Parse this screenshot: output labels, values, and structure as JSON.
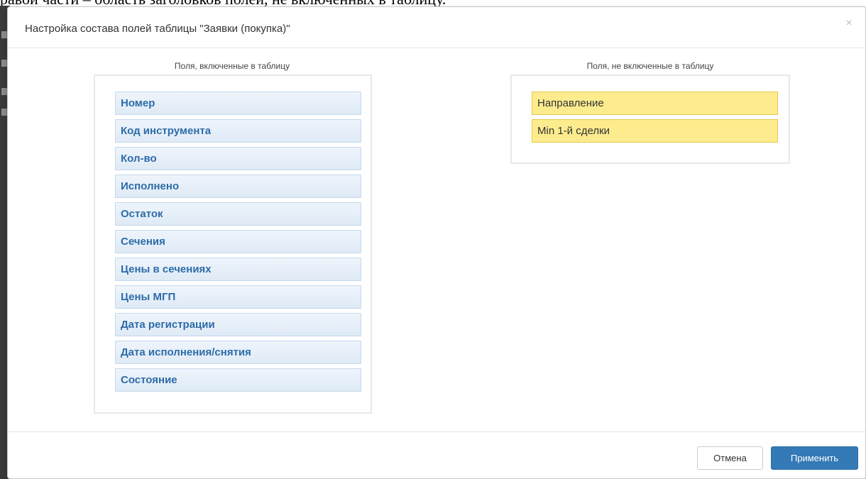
{
  "background": {
    "doc_text": "равой части – область заголовков полей, не включенных в таблицу."
  },
  "dialog": {
    "title": "Настройка состава полей таблицы \"Заявки (покупка)\"",
    "close_label": "×"
  },
  "included": {
    "title": "Поля, включенные в таблицу",
    "fields": [
      "Номер",
      "Код инструмента",
      "Кол-во",
      "Исполнено",
      "Остаток",
      "Сечения",
      "Цены в сечениях",
      "Цены МГП",
      "Дата регистрации",
      "Дата исполнения/снятия",
      "Состояние"
    ]
  },
  "excluded": {
    "title": "Поля, не включенные в таблицу",
    "fields": [
      "Направление",
      "Min 1-й сделки"
    ]
  },
  "footer": {
    "cancel_label": "Отмена",
    "apply_label": "Применить"
  },
  "colors": {
    "included_text": "#2d6ca8",
    "included_bg": "#e6eff9",
    "excluded_bg": "#fdec8e",
    "primary_button": "#337ab7"
  }
}
